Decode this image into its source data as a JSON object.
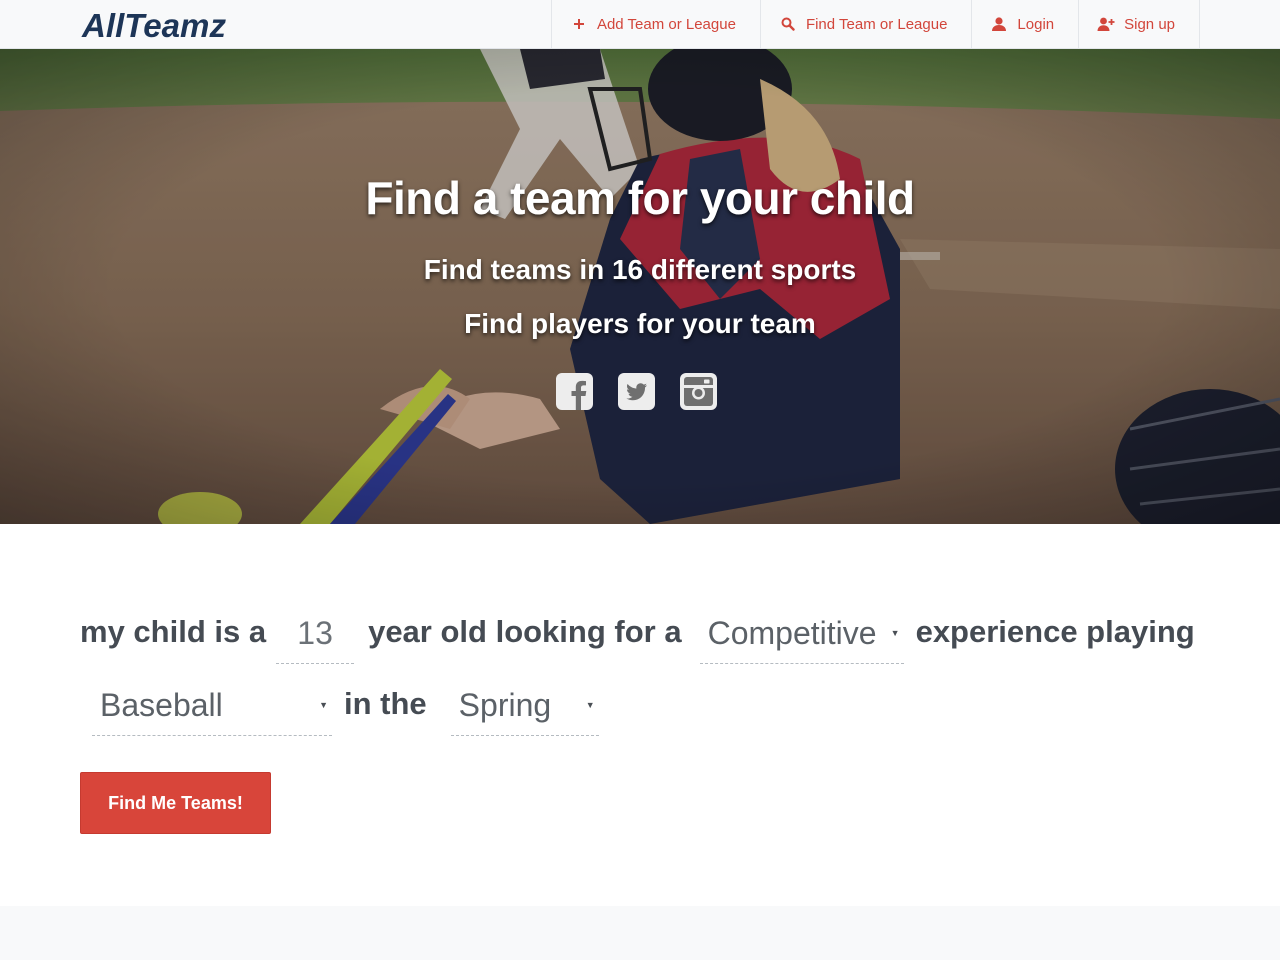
{
  "brand": {
    "logo_text": "AllTeamz",
    "accent": "#d8453a",
    "navy": "#1d3557"
  },
  "nav": {
    "items": [
      {
        "label": "Add Team or League",
        "icon": "plus-icon"
      },
      {
        "label": "Find Team or League",
        "icon": "search-icon"
      },
      {
        "label": "Login",
        "icon": "user-icon"
      },
      {
        "label": "Sign up",
        "icon": "user-plus-icon"
      }
    ]
  },
  "hero": {
    "title": "Find a team for your child",
    "subtitle1": "Find teams in 16 different sports",
    "subtitle2": "Find players for your team",
    "socials": [
      "facebook-icon",
      "twitter-icon",
      "instagram-icon"
    ]
  },
  "search": {
    "part1": "my child is a",
    "age": "13",
    "part2": "year old looking for a",
    "experience": "Competitive",
    "part3": "experience playing",
    "sport": "Baseball",
    "part4": "in the",
    "season": "Spring",
    "submit_label": "Find Me Teams!"
  }
}
